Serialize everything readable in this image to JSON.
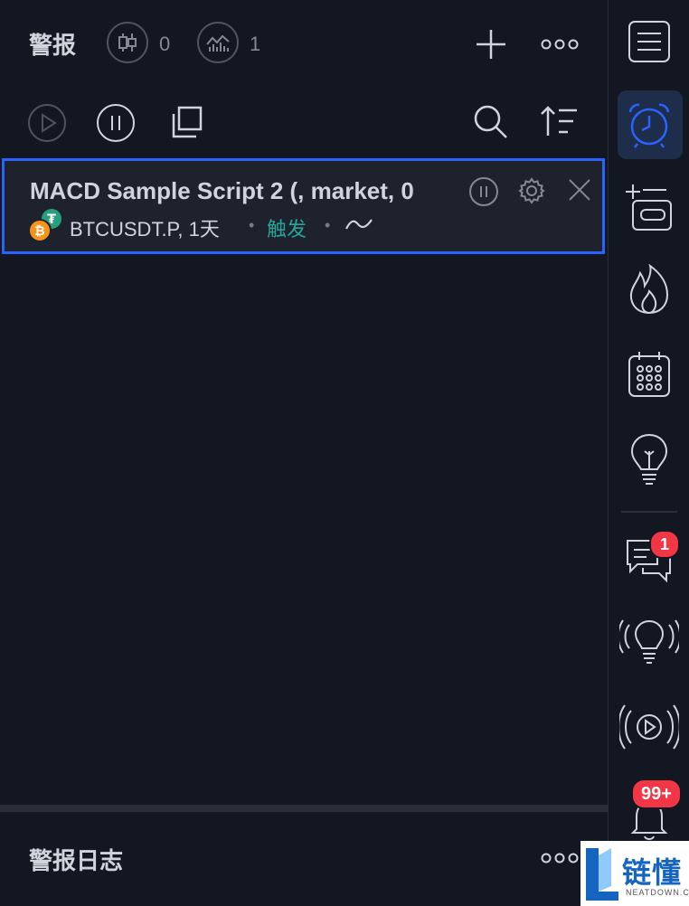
{
  "header": {
    "title": "警报",
    "price_alerts_count": "0",
    "indicator_alerts_count": "1"
  },
  "alert": {
    "title": "MACD Sample Script 2 (, market, 0",
    "symbol": "BTCUSDT.P, 1天",
    "separator": "•",
    "status": "触发"
  },
  "log": {
    "title": "警报日志"
  },
  "sidebar": {
    "chat_badge": "1",
    "notifications_badge": "99+"
  },
  "watermark": {
    "cn": "链懂",
    "en": "NEATDOWN.COM"
  },
  "colors": {
    "background": "#131722",
    "accent": "#2962ff",
    "trigger": "#26a69a",
    "badge": "#f23645"
  }
}
